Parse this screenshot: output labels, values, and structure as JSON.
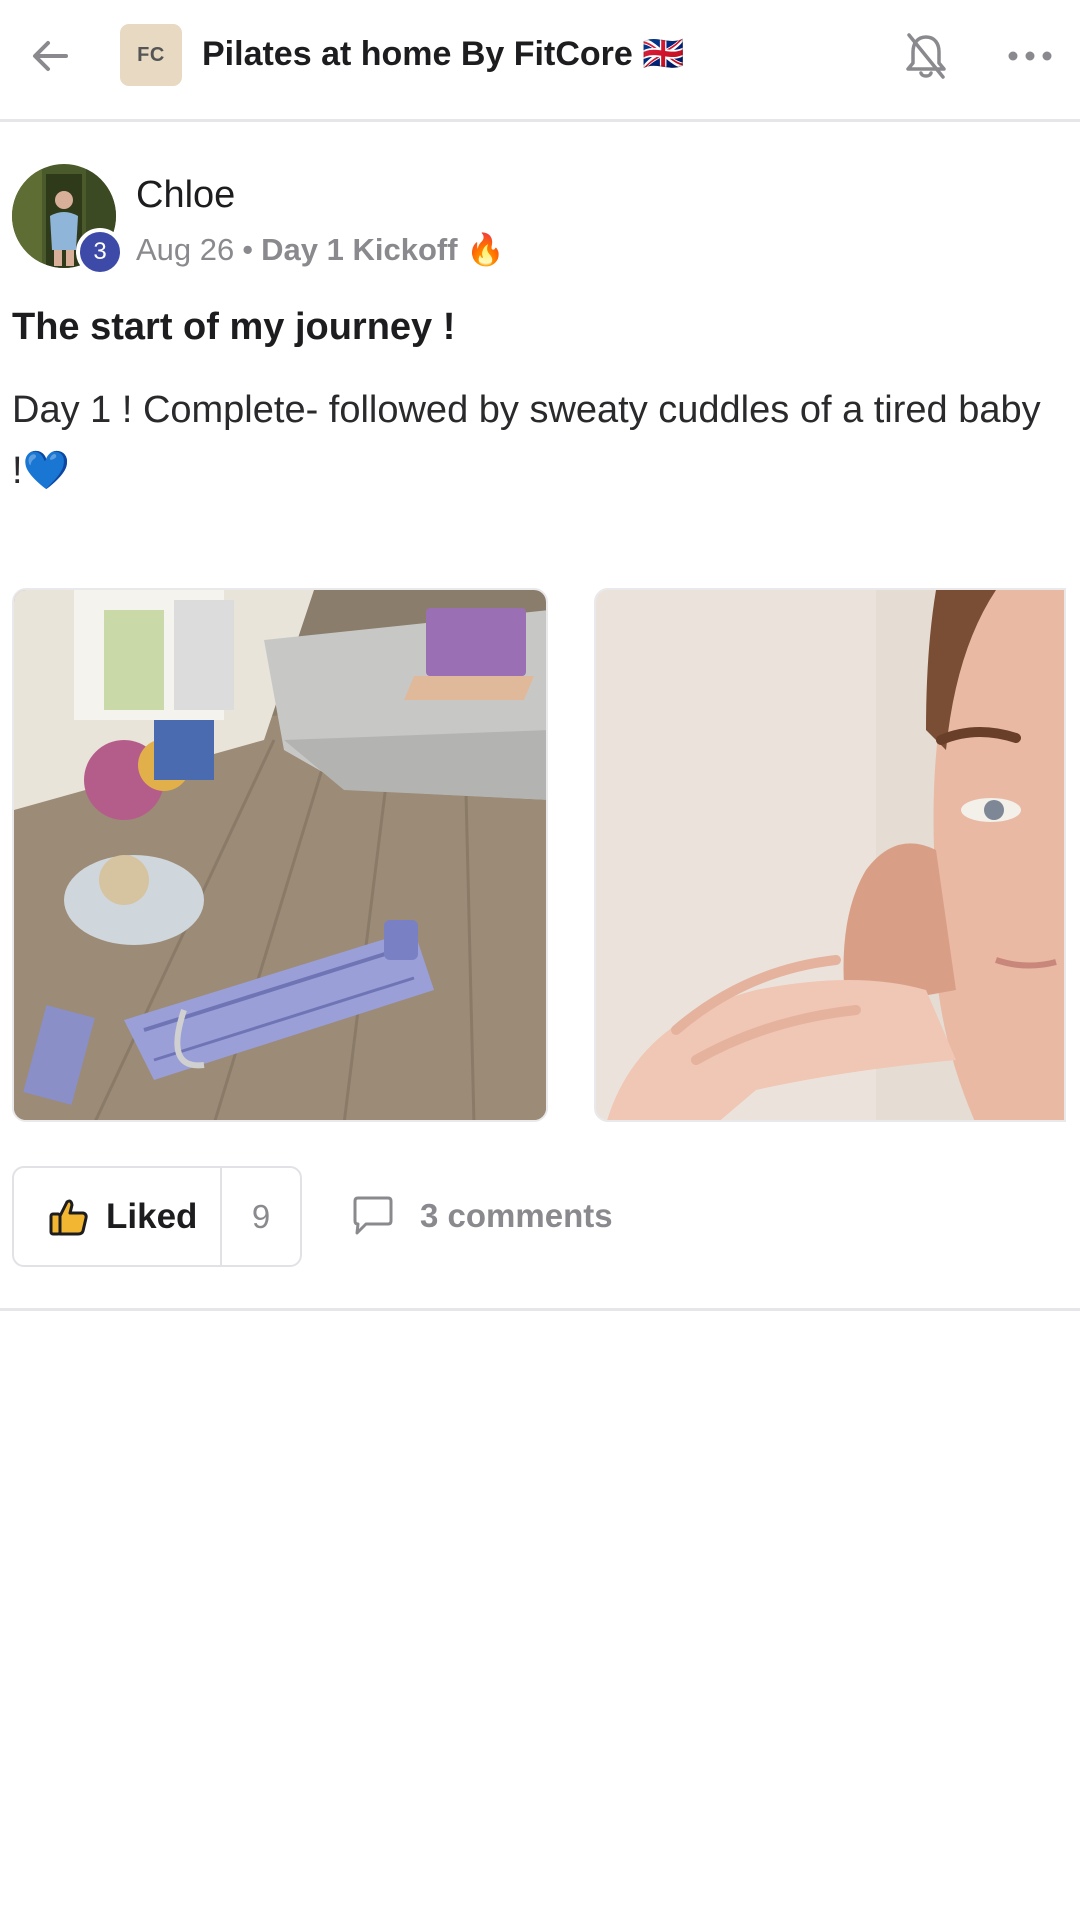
{
  "header": {
    "group_logo_text": "FC",
    "group_title": "Pilates at home By FitCore 🇬🇧",
    "icons": [
      "back-arrow-icon",
      "bell-off-icon",
      "more-horizontal-icon"
    ]
  },
  "post": {
    "author": "Chloe",
    "level_badge": "3",
    "date": "Aug 26",
    "separator": "•",
    "space": "Day 1 Kickoff 🔥",
    "title": "The start of my journey !",
    "body": "Day 1 ! Complete- followed by sweaty cuddles of a tired baby !💙",
    "images": [
      "living-room-pilates-board-photo",
      "selfie-with-baby-photo"
    ]
  },
  "actions": {
    "like_label": "Liked",
    "like_count": "9",
    "comments_label": "3 comments"
  },
  "colors": {
    "accent_badge": "#3d4aa8",
    "liked_icon": "#f2b632",
    "muted_text": "#8a8a8e",
    "logo_bg": "#e8d9c2"
  }
}
